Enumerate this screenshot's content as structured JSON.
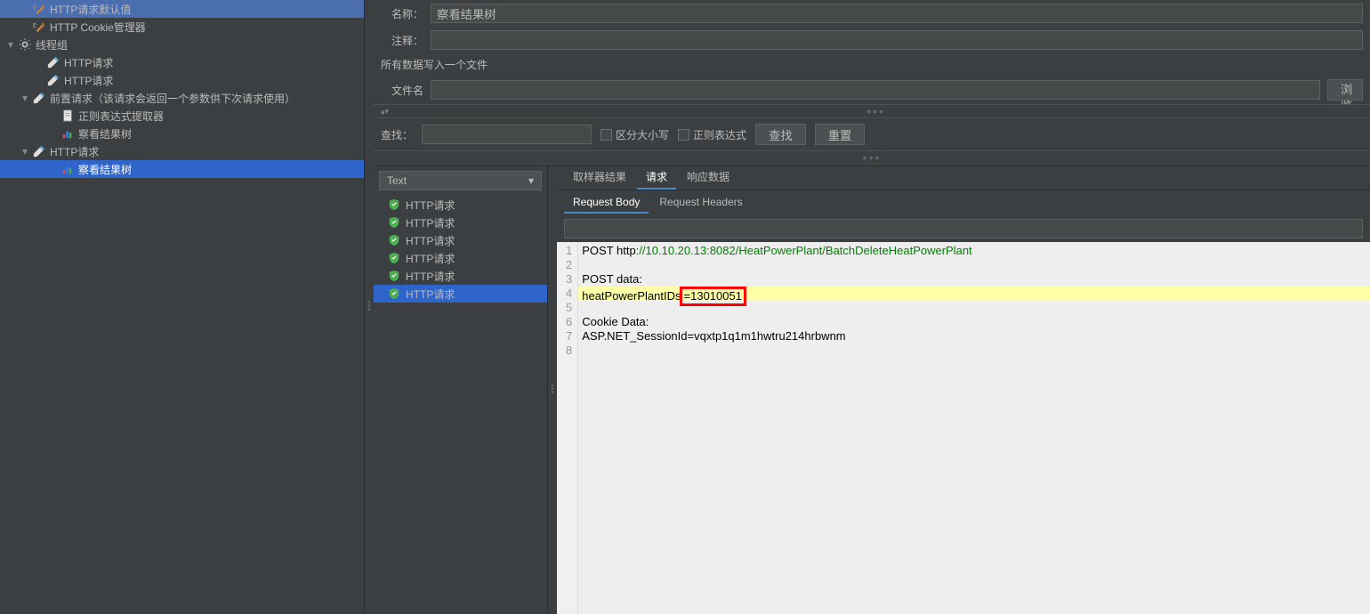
{
  "tree": {
    "items": [
      {
        "indent": 20,
        "toggle": "",
        "icon": "wrench",
        "label": "HTTP请求默认值"
      },
      {
        "indent": 20,
        "toggle": "",
        "icon": "wrench",
        "label": "HTTP Cookie管理器"
      },
      {
        "indent": 4,
        "toggle": "▾",
        "icon": "gear",
        "label": "线程组"
      },
      {
        "indent": 36,
        "toggle": "",
        "icon": "dropper",
        "label": "HTTP请求"
      },
      {
        "indent": 36,
        "toggle": "",
        "icon": "dropper",
        "label": "HTTP请求"
      },
      {
        "indent": 20,
        "toggle": "▾",
        "icon": "dropper",
        "label": "前置请求（该请求会返回一个参数供下次请求使用）"
      },
      {
        "indent": 52,
        "toggle": "",
        "icon": "doc",
        "label": "正则表达式提取器"
      },
      {
        "indent": 52,
        "toggle": "",
        "icon": "chart",
        "label": "察看结果树"
      },
      {
        "indent": 20,
        "toggle": "▾",
        "icon": "dropper",
        "label": "HTTP请求"
      },
      {
        "indent": 52,
        "toggle": "",
        "icon": "chart",
        "label": "察看结果树",
        "selected": true
      }
    ]
  },
  "props": {
    "name_label": "名称：",
    "name_value": "察看结果树",
    "comment_label": "注释：",
    "comment_value": "",
    "file_section": "所有数据写入一个文件",
    "filename_label": "文件名",
    "filename_value": "",
    "browse_label": "浏览..."
  },
  "search": {
    "label": "查找：",
    "value": "",
    "case_label": "区分大小写",
    "regex_label": "正则表达式",
    "find_btn": "查找",
    "reset_btn": "重置"
  },
  "results": {
    "dropdown": "Text",
    "items": [
      {
        "label": "HTTP请求"
      },
      {
        "label": "HTTP请求"
      },
      {
        "label": "HTTP请求"
      },
      {
        "label": "HTTP请求"
      },
      {
        "label": "HTTP请求"
      },
      {
        "label": "HTTP请求",
        "selected": true
      }
    ]
  },
  "tabs": {
    "main": [
      "取样器结果",
      "请求",
      "响应数据"
    ],
    "main_active": 1,
    "sub": [
      "Request Body",
      "Request Headers"
    ],
    "sub_active": 0
  },
  "code": {
    "lines": [
      {
        "n": 1,
        "prefix": "POST http",
        "url": "://10.10.20.13:8082/HeatPowerPlant/BatchDeleteHeatPowerPlant"
      },
      {
        "n": 2,
        "text": ""
      },
      {
        "n": 3,
        "text": "POST data:"
      },
      {
        "n": 4,
        "hl": true,
        "prefix": "heatPowerPlantIDs",
        "boxed": "=13010051"
      },
      {
        "n": 5,
        "text": ""
      },
      {
        "n": 6,
        "text": "Cookie Data:"
      },
      {
        "n": 7,
        "text": "ASP.NET_SessionId=vqxtp1q1m1hwtru214hrbwnm"
      },
      {
        "n": 8,
        "text": ""
      }
    ]
  }
}
